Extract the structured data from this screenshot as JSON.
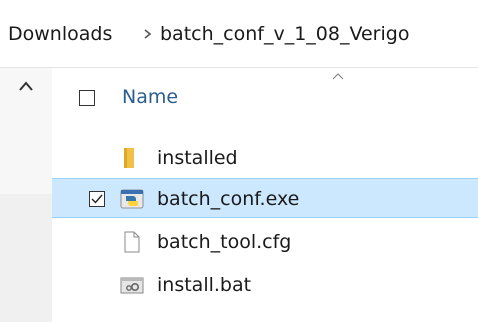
{
  "breadcrumb": {
    "items": [
      "Downloads",
      "batch_conf_v_1_08_Verigo"
    ]
  },
  "list": {
    "header": {
      "name_label": "Name"
    },
    "items": [
      {
        "name": "installed",
        "icon": "folder-icon",
        "selected": false
      },
      {
        "name": "batch_conf.exe",
        "icon": "python-exe-icon",
        "selected": true
      },
      {
        "name": "batch_tool.cfg",
        "icon": "file-icon",
        "selected": false
      },
      {
        "name": "install.bat",
        "icon": "batch-file-icon",
        "selected": false
      }
    ]
  },
  "colors": {
    "selection_bg": "#cce8ff",
    "selection_border": "#99d1ff",
    "header_text": "#2b5d8f",
    "folder": "#f0c04a"
  }
}
